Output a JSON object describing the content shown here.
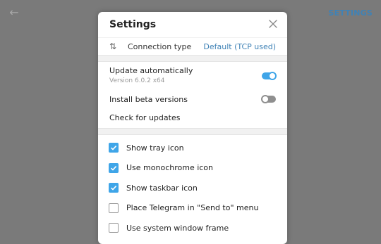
{
  "background": {
    "back_icon": "arrow-left-icon",
    "settings_link": "SETTINGS"
  },
  "modal": {
    "title": "Settings",
    "close_icon": "close-icon",
    "connection": {
      "icon": "sort-arrows-icon",
      "label": "Connection type",
      "value": "Default (TCP used)"
    },
    "update": {
      "auto_label": "Update automatically",
      "version": "Version 6.0.2 x64",
      "auto_on": true,
      "beta_label": "Install beta versions",
      "beta_on": false,
      "check_label": "Check for updates"
    },
    "checkboxes": [
      {
        "label": "Show tray icon",
        "checked": true
      },
      {
        "label": "Use monochrome icon",
        "checked": true
      },
      {
        "label": "Show taskbar icon",
        "checked": true
      },
      {
        "label": "Place Telegram in \"Send to\" menu",
        "checked": false
      },
      {
        "label": "Use system window frame",
        "checked": false
      }
    ],
    "colors": {
      "accent": "#3fa5e8",
      "link": "#3f82b6"
    }
  }
}
